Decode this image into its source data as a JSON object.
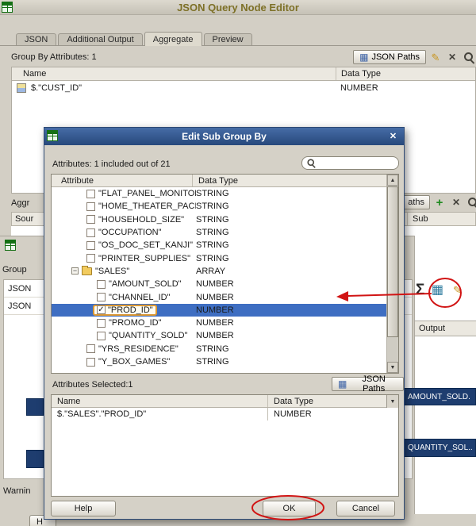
{
  "window": {
    "title": "JSON Query Node Editor"
  },
  "tabs": [
    {
      "label": "JSON"
    },
    {
      "label": "Additional Output"
    },
    {
      "label": "Aggregate"
    },
    {
      "label": "Preview"
    }
  ],
  "icons": {
    "grid": "▦",
    "pencil": "✎",
    "x": "✕",
    "plus": "+",
    "sigma": "Σ",
    "minus": "−",
    "check": "✓",
    "up": "▲",
    "down": "▼",
    "close": "✕",
    "dropdown": "▼"
  },
  "colors": {
    "selection": "#3e6ec2",
    "bar_navy": "#1e3d6f",
    "annotation": "#d11414",
    "title_olive": "#7d7026"
  },
  "group_by_section": {
    "label": "Group By Attributes: 1",
    "json_paths_label": "JSON Paths",
    "columns": {
      "name": "Name",
      "type": "Data Type"
    },
    "row": {
      "name": "$.\"CUST_ID\"",
      "type": "NUMBER"
    }
  },
  "background_fragments": {
    "aggregate_label_cut": "Aggr",
    "paths_button_cut": "aths",
    "source_header_cut": "Sour",
    "sub_header_cut": "Sub",
    "group_label_cut": "Group",
    "json_row_1": "JSON",
    "json_row_2": "JSON",
    "output_header": "Output",
    "amount_bar": "AMOUNT_SOLD.",
    "quantity_bar": "QUANTITY_SOL..",
    "warning_cut": "Warnin",
    "help_cut": "H"
  },
  "dialog": {
    "title": "Edit Sub Group By",
    "attributes_label": "Attributes: 1 included out of 21",
    "tree": {
      "columns": {
        "attribute": "Attribute",
        "type": "Data Type"
      },
      "rows": [
        {
          "label": "\"FLAT_PANEL_MONITOR\"",
          "type": "STRING",
          "level": 1,
          "kind": "leaf",
          "checked": false
        },
        {
          "label": "\"HOME_THEATER_PACKAG",
          "type": "STRING",
          "level": 1,
          "kind": "leaf",
          "checked": false
        },
        {
          "label": "\"HOUSEHOLD_SIZE\"",
          "type": "STRING",
          "level": 1,
          "kind": "leaf",
          "checked": false
        },
        {
          "label": "\"OCCUPATION\"",
          "type": "STRING",
          "level": 1,
          "kind": "leaf",
          "checked": false
        },
        {
          "label": "\"OS_DOC_SET_KANJI\"",
          "type": "STRING",
          "level": 1,
          "kind": "leaf",
          "checked": false
        },
        {
          "label": "\"PRINTER_SUPPLIES\"",
          "type": "STRING",
          "level": 1,
          "kind": "leaf",
          "checked": false
        },
        {
          "label": "\"SALES\"",
          "type": "ARRAY",
          "level": 1,
          "kind": "folder",
          "expanded": true
        },
        {
          "label": "\"AMOUNT_SOLD\"",
          "type": "NUMBER",
          "level": 2,
          "kind": "leaf",
          "checked": false
        },
        {
          "label": "\"CHANNEL_ID\"",
          "type": "NUMBER",
          "level": 2,
          "kind": "leaf",
          "checked": false
        },
        {
          "label": "\"PROD_ID\"",
          "type": "NUMBER",
          "level": 2,
          "kind": "leaf",
          "checked": true,
          "selected": true
        },
        {
          "label": "\"PROMO_ID\"",
          "type": "NUMBER",
          "level": 2,
          "kind": "leaf",
          "checked": false
        },
        {
          "label": "\"QUANTITY_SOLD\"",
          "type": "NUMBER",
          "level": 2,
          "kind": "leaf",
          "checked": false
        },
        {
          "label": "\"YRS_RESIDENCE\"",
          "type": "STRING",
          "level": 1,
          "kind": "leaf",
          "checked": false
        },
        {
          "label": "\"Y_BOX_GAMES\"",
          "type": "STRING",
          "level": 1,
          "kind": "leaf",
          "checked": false
        }
      ]
    },
    "selected_section": {
      "label": "Attributes Selected:1",
      "json_paths_label": "JSON Paths",
      "columns": {
        "name": "Name",
        "type": "Data Type"
      },
      "row": {
        "name": "$.\"SALES\".\"PROD_ID\"",
        "type": "NUMBER"
      }
    },
    "buttons": {
      "help": "Help",
      "ok": "OK",
      "cancel": "Cancel"
    }
  }
}
